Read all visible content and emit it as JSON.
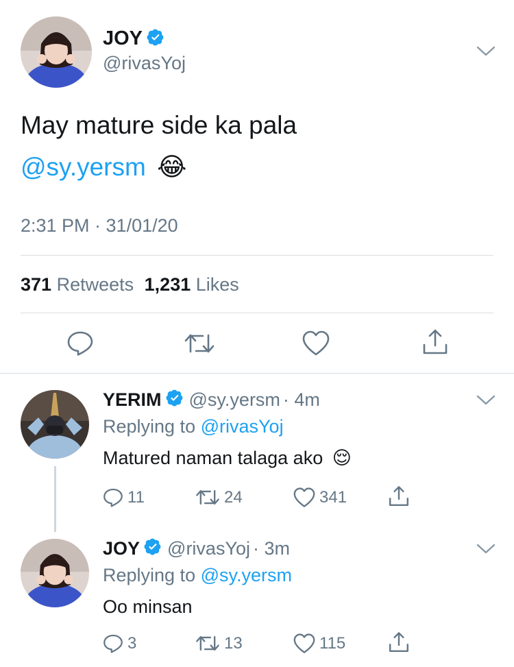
{
  "main_tweet": {
    "author_name": "JOY",
    "author_handle": "@rivasYoj",
    "text": "May mature side ka pala",
    "mention": "@sy.yersm",
    "emoji": "😂",
    "timestamp": "2:31 PM · 31/01/20",
    "retweets_count": "371",
    "retweets_label": "Retweets",
    "likes_count": "1,231",
    "likes_label": "Likes"
  },
  "replies": [
    {
      "author_name": "YERIM",
      "author_handle": "@sy.yersm",
      "time": "· 4m",
      "replying_label": "Replying to",
      "replying_to": "@rivasYoj",
      "text": "Matured naman talaga ako",
      "emoji": "😌",
      "reply_count": "11",
      "retweet_count": "24",
      "like_count": "341"
    },
    {
      "author_name": "JOY",
      "author_handle": "@rivasYoj",
      "time": "· 3m",
      "replying_label": "Replying to",
      "replying_to": "@sy.yersm",
      "text": "Oo minsan",
      "emoji": "",
      "reply_count": "3",
      "retweet_count": "13",
      "like_count": "115"
    }
  ],
  "colors": {
    "accent": "#1da1f2",
    "muted": "#657786",
    "text": "#14171a",
    "divider": "#d9dee2"
  },
  "icons": [
    "verified-badge-icon",
    "chevron-down-icon",
    "reply-icon",
    "retweet-icon",
    "like-icon",
    "share-icon"
  ]
}
